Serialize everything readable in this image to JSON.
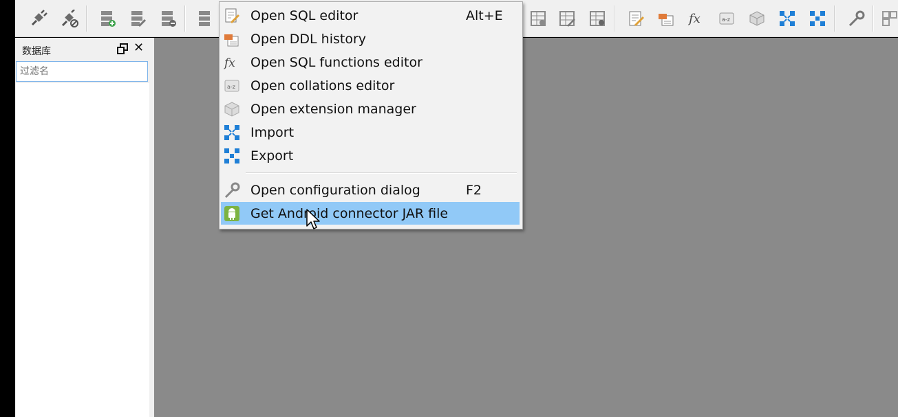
{
  "toolbar": {
    "buttons": [
      {
        "icon": "connect-icon"
      },
      {
        "icon": "disconnect-icon"
      },
      {
        "icon": "add-database-icon"
      },
      {
        "icon": "edit-database-icon"
      },
      {
        "icon": "remove-database-icon"
      },
      {
        "icon": "refresh-database-icon"
      },
      {
        "icon": "add-table-icon"
      },
      {
        "icon": "edit-table-icon"
      },
      {
        "icon": "delete-table-icon"
      },
      {
        "icon": "sql-editor-icon"
      },
      {
        "icon": "ddl-history-icon"
      },
      {
        "icon": "sql-functions-icon"
      },
      {
        "icon": "collations-icon"
      },
      {
        "icon": "extension-manager-icon"
      },
      {
        "icon": "import-icon"
      },
      {
        "icon": "export-icon"
      },
      {
        "icon": "configuration-icon"
      }
    ]
  },
  "dock": {
    "title": "数据库",
    "filter_placeholder": "过滤名"
  },
  "menu": {
    "items": [
      {
        "label": "Open SQL editor",
        "shortcut": "Alt+E",
        "icon": "sql-editor-icon"
      },
      {
        "label": "Open DDL history",
        "shortcut": "",
        "icon": "ddl-history-icon"
      },
      {
        "label": "Open SQL functions editor",
        "shortcut": "",
        "icon": "sql-functions-icon"
      },
      {
        "label": "Open collations editor",
        "shortcut": "",
        "icon": "collations-icon"
      },
      {
        "label": "Open extension manager",
        "shortcut": "",
        "icon": "extension-manager-icon"
      },
      {
        "label": "Import",
        "shortcut": "",
        "icon": "import-icon"
      },
      {
        "label": "Export",
        "shortcut": "",
        "icon": "export-icon"
      },
      {
        "label": "Open configuration dialog",
        "shortcut": "F2",
        "icon": "configuration-icon"
      },
      {
        "label": "Get Android connector JAR file",
        "shortcut": "",
        "icon": "android-icon",
        "highlighted": true
      }
    ]
  },
  "colors": {
    "highlight": "#91c9f7",
    "mdi_background": "#8a8a8a",
    "input_border": "#7eb4ea",
    "import_export_blue": "#1f7fd6",
    "android_green": "#7cb342"
  }
}
